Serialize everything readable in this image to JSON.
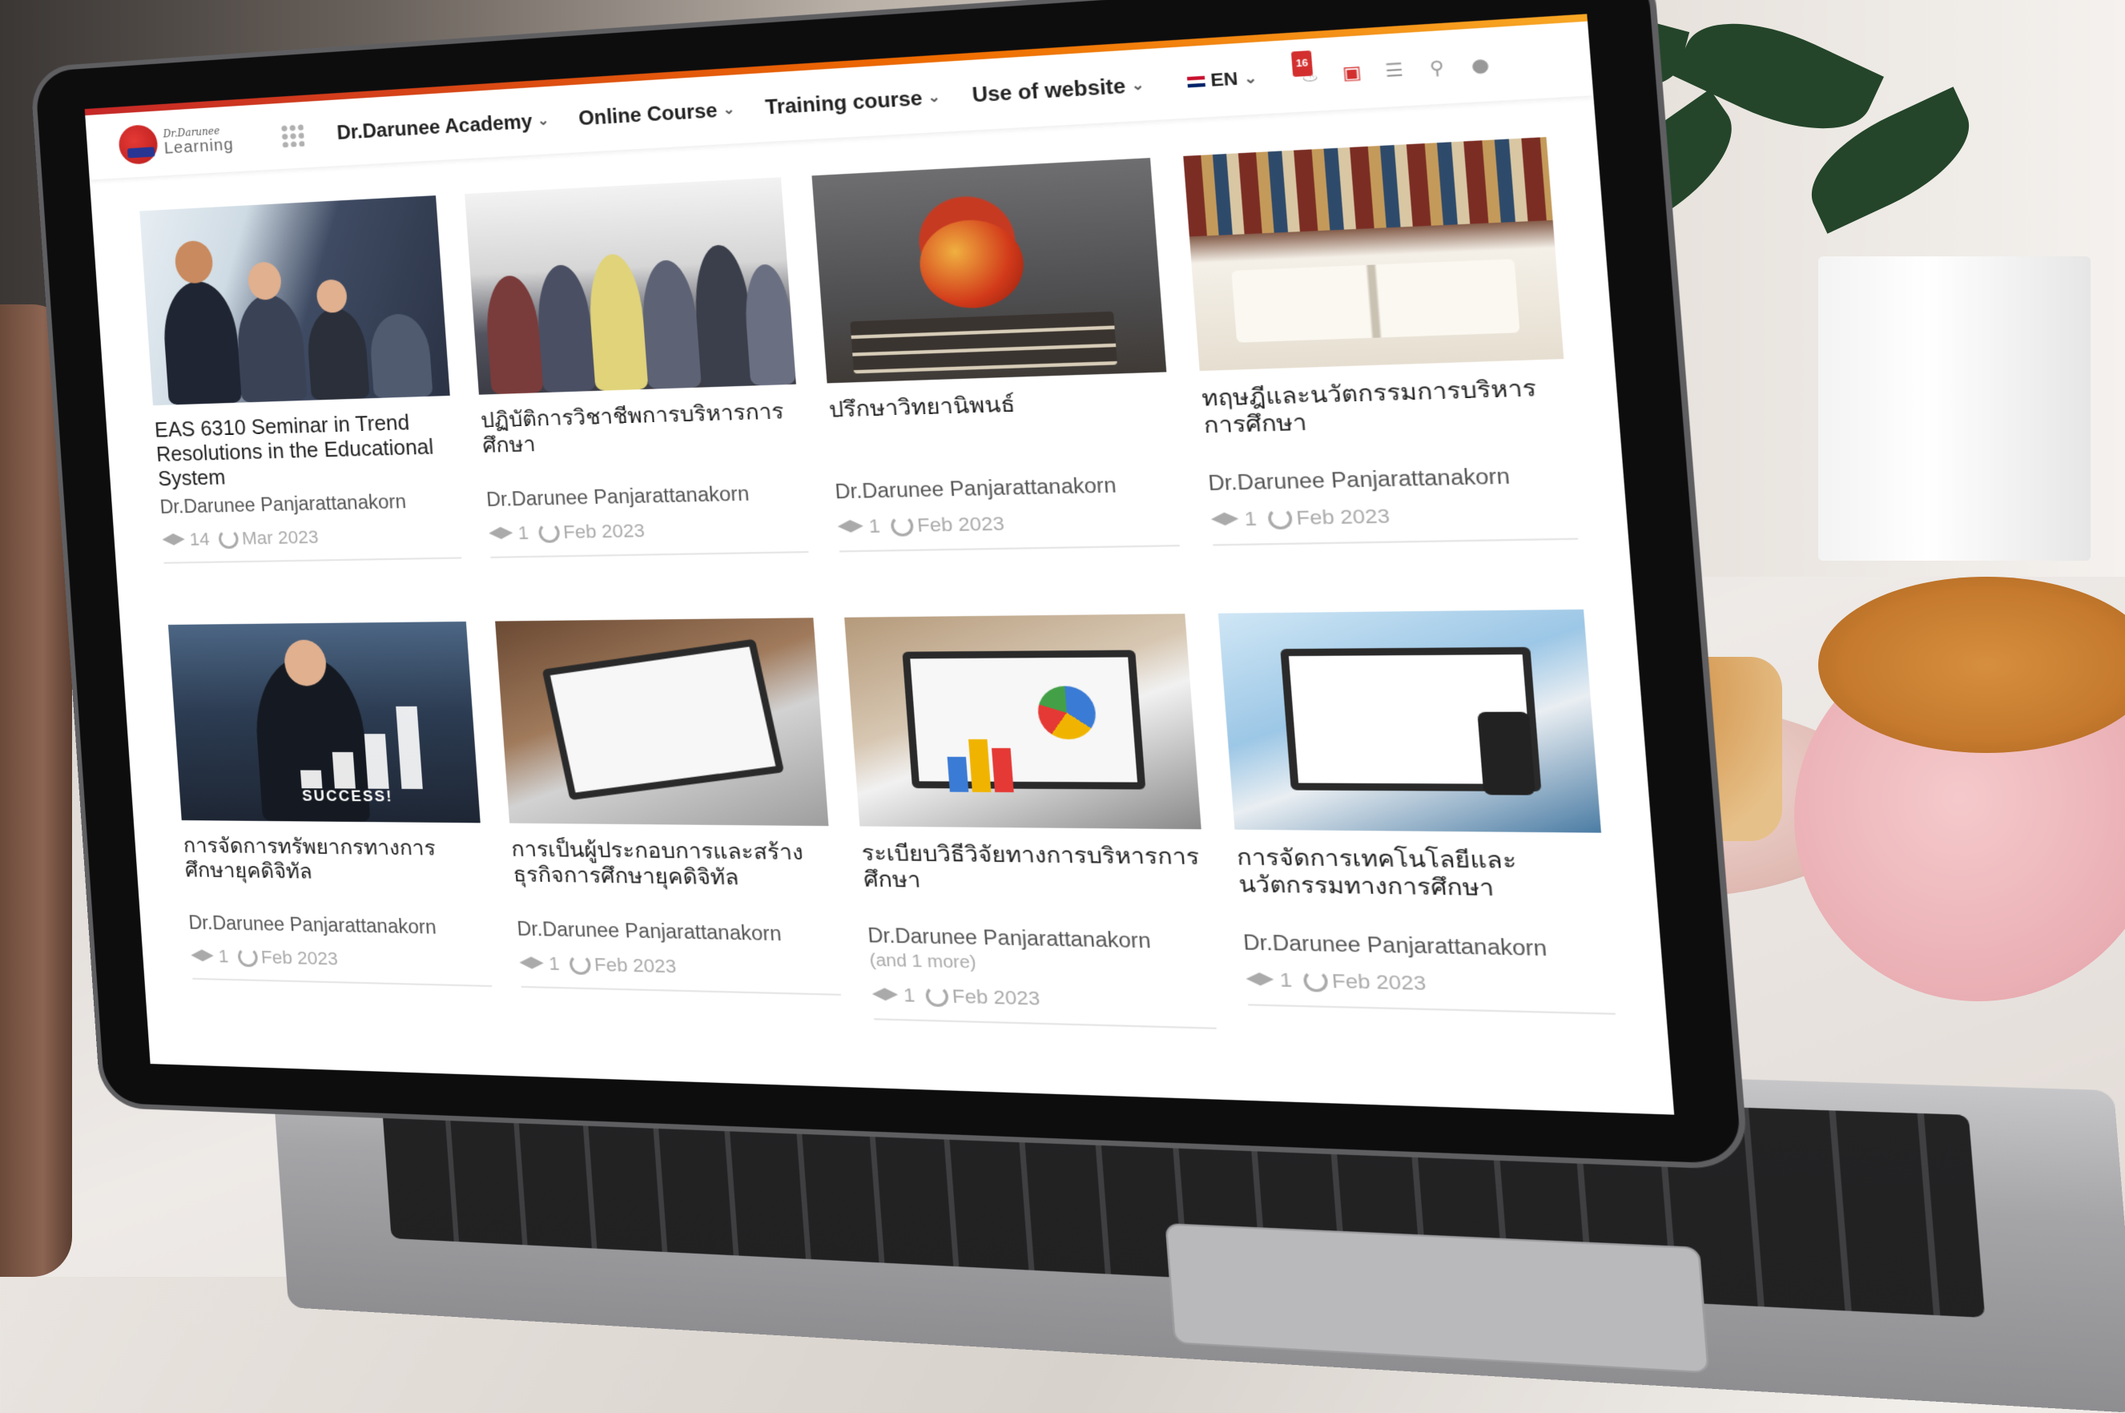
{
  "nav": {
    "logo_top": "Dr.Darunee",
    "logo_bottom": "Learning",
    "menu": [
      {
        "label": "Dr.Darunee Academy"
      },
      {
        "label": "Online Course"
      },
      {
        "label": "Training course"
      },
      {
        "label": "Use of website"
      }
    ],
    "language": "EN",
    "notification_count": "16",
    "icons": [
      "apps-grid-icon",
      "bell-icon",
      "book-icon",
      "settings-icon",
      "search-icon",
      "user-icon"
    ]
  },
  "courses": [
    {
      "title": "EAS 6310 Seminar in Trend Resolutions in the Educational System",
      "author": "Dr.Darunee Panjarattanakorn",
      "students": "14",
      "date": "Mar 2023"
    },
    {
      "title": "ปฏิบัติการวิชาชีพการบริหารการศึกษา",
      "author": "Dr.Darunee Panjarattanakorn",
      "students": "1",
      "date": "Feb 2023"
    },
    {
      "title": "ปรึกษาวิทยานิพนธ์",
      "author": "Dr.Darunee Panjarattanakorn",
      "students": "1",
      "date": "Feb 2023"
    },
    {
      "title": "ทฤษฎีและนวัตกรรมการบริหารการศึกษา",
      "author": "Dr.Darunee Panjarattanakorn",
      "students": "1",
      "date": "Feb 2023"
    },
    {
      "title": "การจัดการทรัพยากรทางการศึกษายุคดิจิทัล",
      "author": "Dr.Darunee Panjarattanakorn",
      "students": "1",
      "date": "Feb 2023"
    },
    {
      "title": "การเป็นผู้ประกอบการและสร้างธุรกิจการศึกษายุคดิจิทัล",
      "author": "Dr.Darunee Panjarattanakorn",
      "students": "1",
      "date": "Feb 2023"
    },
    {
      "title": "ระเบียบวิธีวิจัยทางการบริหารการศึกษา",
      "author": "Dr.Darunee Panjarattanakorn",
      "more": "(and 1 more)",
      "students": "1",
      "date": "Feb 2023"
    },
    {
      "title": "การจัดการเทคโนโลยีและนวัตกรรมทางการศึกษา",
      "author": "Dr.Darunee Panjarattanakorn",
      "students": "1",
      "date": "Feb 2023"
    }
  ],
  "thumb_text": {
    "success": "SUCCESS!"
  },
  "colors": {
    "accent_red": "#c62828",
    "accent_orange": "#ef6c00",
    "text_muted": "#aaaaaa"
  }
}
